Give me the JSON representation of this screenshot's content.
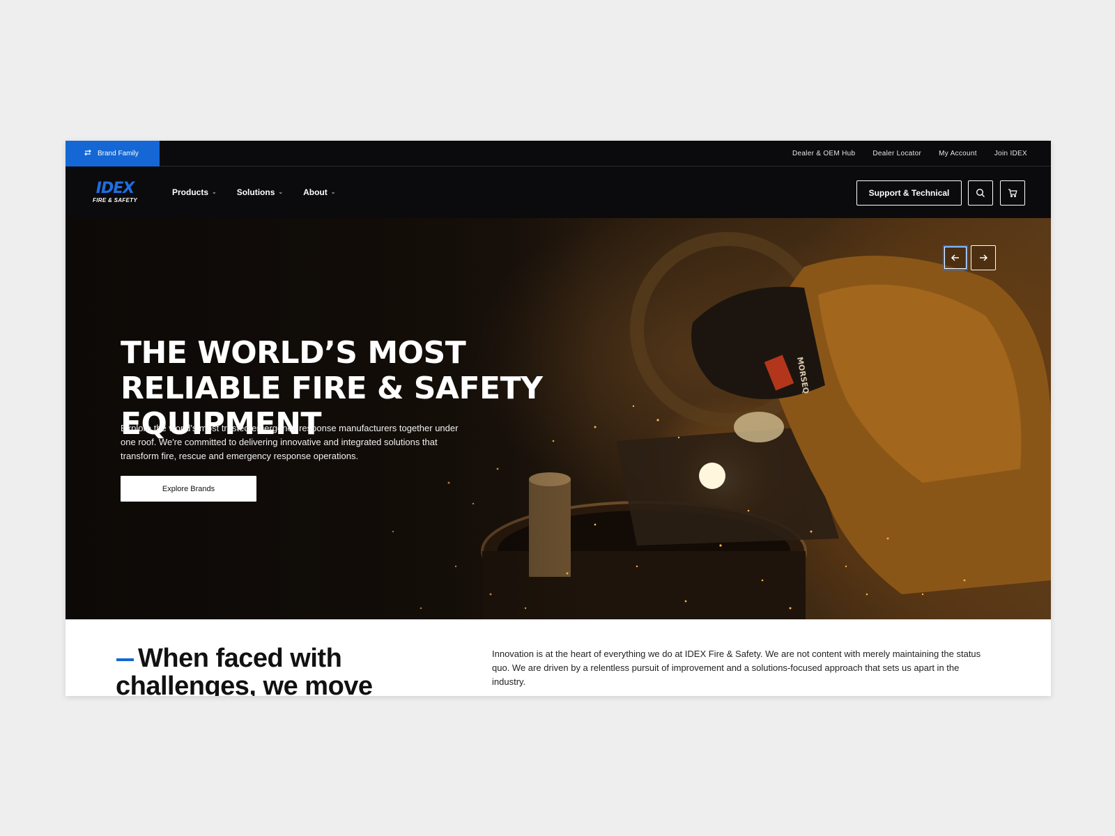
{
  "utility_bar": {
    "brand_family_label": "Brand Family",
    "links": [
      "Dealer & OEM Hub",
      "Dealer Locator",
      "My Account",
      "Join IDEX"
    ]
  },
  "logo": {
    "mark": "IDEX",
    "sub": "FIRE & SAFETY"
  },
  "nav": {
    "items": [
      "Products",
      "Solutions",
      "About"
    ],
    "support_label": "Support & Technical"
  },
  "hero": {
    "title": "The World’s Most Reliable Fire & Safety Equipment",
    "description": "Explore the world's most trusted emergency response manufacturers together under one roof. We're committed to delivering innovative and integrated solutions that transform fire, rescue and emergency response operations.",
    "cta_label": "Explore Brands",
    "helmet_text": "MORSEQ"
  },
  "intro": {
    "heading": "When faced with challenges, we move",
    "text": "Innovation is at the heart of everything we do at IDEX Fire & Safety. We are not content with merely maintaining the status quo. We are driven by a relentless pursuit of improvement and a solutions-focused approach that sets us apart in the industry."
  },
  "colors": {
    "accent": "#1467d4",
    "nav_bg": "#0b0b0d",
    "page_bg": "#eeeeee"
  },
  "icons": [
    "swap-icon",
    "search-icon",
    "cart-icon",
    "arrow-left-icon",
    "arrow-right-icon",
    "chevron-down-icon"
  ]
}
